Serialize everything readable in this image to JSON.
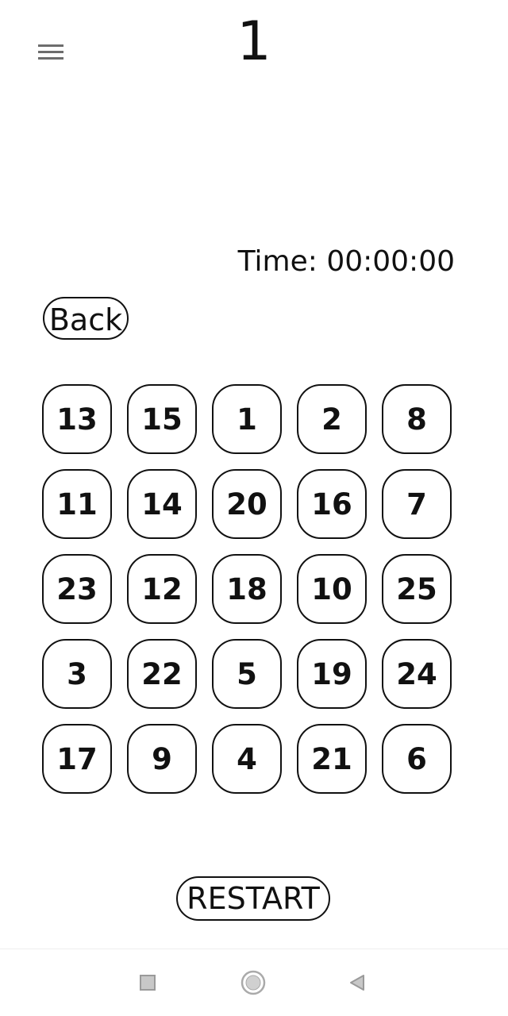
{
  "header": {
    "title": "1",
    "menu_icon": "hamburger-menu-icon"
  },
  "timer": {
    "text": "Time: 00:00:00"
  },
  "buttons": {
    "back_label": "Back",
    "restart_label": "RESTART"
  },
  "grid": {
    "rows": [
      [
        "13",
        "15",
        "1",
        "2",
        "8"
      ],
      [
        "11",
        "14",
        "20",
        "16",
        "7"
      ],
      [
        "23",
        "12",
        "18",
        "10",
        "25"
      ],
      [
        "3",
        "22",
        "5",
        "19",
        "24"
      ],
      [
        "17",
        "9",
        "4",
        "21",
        "6"
      ]
    ]
  },
  "navbar": {
    "icons": [
      "square-recents-icon",
      "circle-home-icon",
      "triangle-back-icon"
    ]
  },
  "colors": {
    "background": "#ffffff",
    "text": "#111111",
    "menu_icon": "#6d6d6d",
    "nav_icon": "#aaaaaa"
  }
}
